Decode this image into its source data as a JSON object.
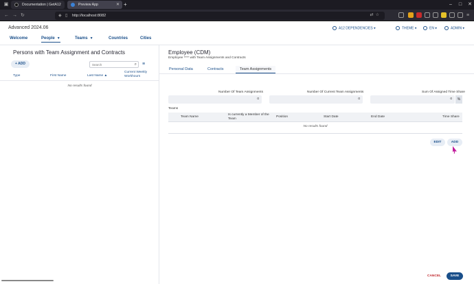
{
  "browser": {
    "tabs": [
      {
        "label": "Documentation | GetA12",
        "icon_color": "#1c1b22"
      },
      {
        "label": "Preview App",
        "icon_color": "#3b82d6"
      }
    ],
    "url": "http://localhost:8082"
  },
  "app": {
    "title": "Advanced 2024.06",
    "nav": [
      {
        "label": "Welcome"
      },
      {
        "label": "People"
      },
      {
        "label": "Teams"
      },
      {
        "label": "Countries"
      },
      {
        "label": "Cities"
      }
    ],
    "header_right": {
      "dependencies": "A12 DEPENDENCIES",
      "theme": "THEME",
      "language": "EN",
      "user": "ADMIN"
    }
  },
  "left_panel": {
    "title": "Persons with Team Assignment and Contracts",
    "add_label": "+ ADD",
    "search_placeholder": "Search",
    "columns": [
      "Type",
      "First Name",
      "Last Name ▲",
      "Current Weekly Workhours"
    ],
    "empty_text": "No results found"
  },
  "right_panel": {
    "title": "Employee (CDM)",
    "subtitle": "Employee **** with Team Assignments and Contracts",
    "tabs": [
      {
        "label": "Personal Data"
      },
      {
        "label": "Contracts"
      },
      {
        "label": "Team Assignments"
      }
    ],
    "fields": [
      {
        "label": "Number Of Team Assignments",
        "value": "0"
      },
      {
        "label": "Number Of Current Team Assignments",
        "value": "0"
      },
      {
        "label": "Sum Of Assigned Time Share",
        "value": "0",
        "unit": "%"
      }
    ],
    "teams_label": "Teams",
    "table_columns": [
      "Team Name",
      "Is currently a Member of the Team",
      "Position",
      "Start Date",
      "End Date",
      "Time Share"
    ],
    "table_empty": "No results found",
    "edit_label": "EDIT",
    "add_label": "ADD",
    "cancel_label": "CANCEL",
    "save_label": "SAVE"
  }
}
